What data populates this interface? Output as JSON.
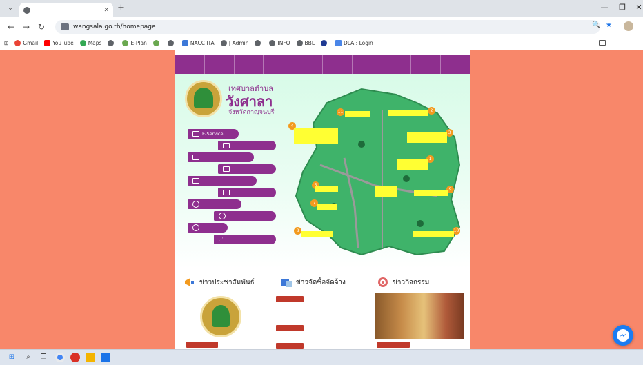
{
  "browser": {
    "tab_title": "",
    "tab_close": "✕",
    "new_tab": "+",
    "dropdown": "⌄",
    "url": "wangsala.go.th/homepage",
    "window_controls": {
      "minimize": "—",
      "maximize": "❐",
      "close": "✕"
    }
  },
  "bookmarks": [
    {
      "label": "Gmail",
      "icon": "gmail-icon"
    },
    {
      "label": "YouTube",
      "icon": "youtube-icon"
    },
    {
      "label": "Maps",
      "icon": "maps-icon"
    },
    {
      "label": "",
      "icon": "globe-icon"
    },
    {
      "label": "E-Plan",
      "icon": "globe-icon"
    },
    {
      "label": "",
      "icon": "globe-icon"
    },
    {
      "label": "",
      "icon": "globe-icon"
    },
    {
      "label": "NACC ITA",
      "icon": "nacc-icon"
    },
    {
      "label": "| Admin",
      "icon": "globe-icon"
    },
    {
      "label": "",
      "icon": "globe-icon"
    },
    {
      "label": "INFO",
      "icon": "globe-icon"
    },
    {
      "label": "BBL",
      "icon": "globe-icon"
    },
    {
      "label": "",
      "icon": "globe-icon"
    },
    {
      "label": "DLA : Login",
      "icon": "folder-icon"
    }
  ],
  "bookmarks_all": "",
  "site": {
    "nav": [
      "",
      "",
      "",
      "",
      "",
      "",
      "",
      "",
      "",
      ""
    ],
    "brand": {
      "line1": "เทศบาลตำบล",
      "line2": "วังศาลา",
      "line3": "จังหวัดกาญจนบุรี"
    },
    "side_buttons": [
      {
        "label": "E-Service",
        "icon": "monitor-icon"
      },
      {
        "label": "",
        "icon": "scales-icon"
      },
      {
        "label": "",
        "icon": "chart-icon"
      },
      {
        "label": "",
        "icon": "book-icon"
      },
      {
        "label": "",
        "icon": "form-icon"
      },
      {
        "label": "",
        "icon": "home-icon"
      },
      {
        "label": "",
        "icon": "circle-icon"
      },
      {
        "label": "",
        "icon": "pin-icon"
      },
      {
        "label": "",
        "icon": "play-icon"
      },
      {
        "label": "",
        "icon": "share-icon"
      }
    ],
    "map_pois": [
      {
        "num": "1",
        "label": ""
      },
      {
        "num": "2",
        "label": ""
      },
      {
        "num": "3",
        "label": ""
      },
      {
        "num": "4",
        "label": ""
      },
      {
        "num": "5",
        "label": ""
      },
      {
        "num": "6",
        "label": ""
      },
      {
        "num": "7",
        "label": ""
      },
      {
        "num": "8",
        "label": ""
      },
      {
        "num": "9",
        "label": ""
      },
      {
        "num": "10",
        "label": ""
      },
      {
        "num": "11",
        "label": ""
      }
    ],
    "news": [
      {
        "title": "ข่าวประชาสัมพันธ์",
        "badge": "",
        "text": ""
      },
      {
        "title": "ข่าวจัดซื้อจัดจ้าง",
        "items": [
          {
            "badge": "",
            "text": ""
          },
          {
            "badge": "",
            "text": ""
          },
          {
            "badge": "",
            "text": ""
          }
        ]
      },
      {
        "title": "ข่าวกิจกรรม",
        "badge": "",
        "text": ""
      }
    ]
  },
  "taskbar": {
    "tray_text": "",
    "clock": ""
  },
  "colors": {
    "page_bg": "#f8876a",
    "nav_purple": "#8e2f8e",
    "poi_yellow": "#ffff33",
    "poi_orange": "#f39a1e",
    "map_green": "#3fb36a"
  }
}
